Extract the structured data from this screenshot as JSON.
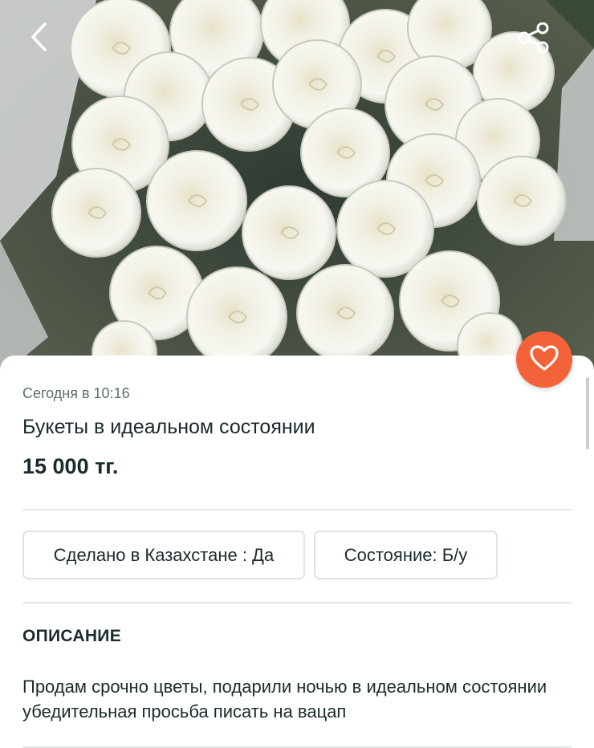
{
  "listing": {
    "posted": "Сегодня в 10:16",
    "title": "Букеты в идеальном состоянии",
    "price": "15 000 тг."
  },
  "attributes": [
    {
      "label": "Сделано в Казахстане : Да"
    },
    {
      "label": "Состояние: Б/у"
    }
  ],
  "description": {
    "heading": "ОПИСАНИЕ",
    "text": "Продам срочно цветы, подарили ночью в идеальном состоянии убедительная просьба писать на вацап"
  },
  "icons": {
    "back": "chevron-left-icon",
    "share": "share-icon",
    "favorite": "heart-icon"
  },
  "colors": {
    "favorite_button": "#f4623a",
    "text_primary": "#1b2b2d",
    "text_secondary": "#5e6f72",
    "divider": "#e3e8e9"
  }
}
